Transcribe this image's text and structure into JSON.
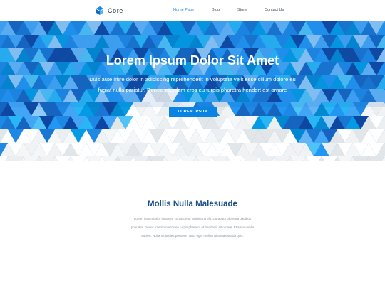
{
  "brand": {
    "name": "Core",
    "icon": "cube-logo-icon"
  },
  "nav": {
    "items": [
      {
        "label": "Home Page",
        "active": true
      },
      {
        "label": "Blog",
        "active": false
      },
      {
        "label": "Store",
        "active": false
      },
      {
        "label": "Contact Us",
        "active": false
      }
    ]
  },
  "hero": {
    "title": "Lorem Ipsum Dolor Sit Amet",
    "subtitle_lines": [
      "Duis aute irure dolor in adipiscing reprehenderit in voluptate velit esse cillum dolore eu",
      "fugiat nulla pariatur. Donec interdum eros eu turpis pharetra hendert est ornare"
    ],
    "button_label": "LOREM IPSUM"
  },
  "section": {
    "title": "Mollis Nulla Malesuade",
    "body_lines": [
      "Lorem ipsum dolor sit amet, consectetur adipiscing elit. Curabitur pharetra dapibus",
      "pharetra. Donec interdum eros eu turpis pharetra et hendrerit sit ornare. Etiam eu nulla",
      "sapien. Nullam ultricies posuere nunc, eget mollis nulla malesuada quis."
    ]
  },
  "colors": {
    "accent": "#1e88e5",
    "heading": "#1b4f8a",
    "body_text": "#8c969f",
    "nav_text": "#3c4b5c"
  }
}
